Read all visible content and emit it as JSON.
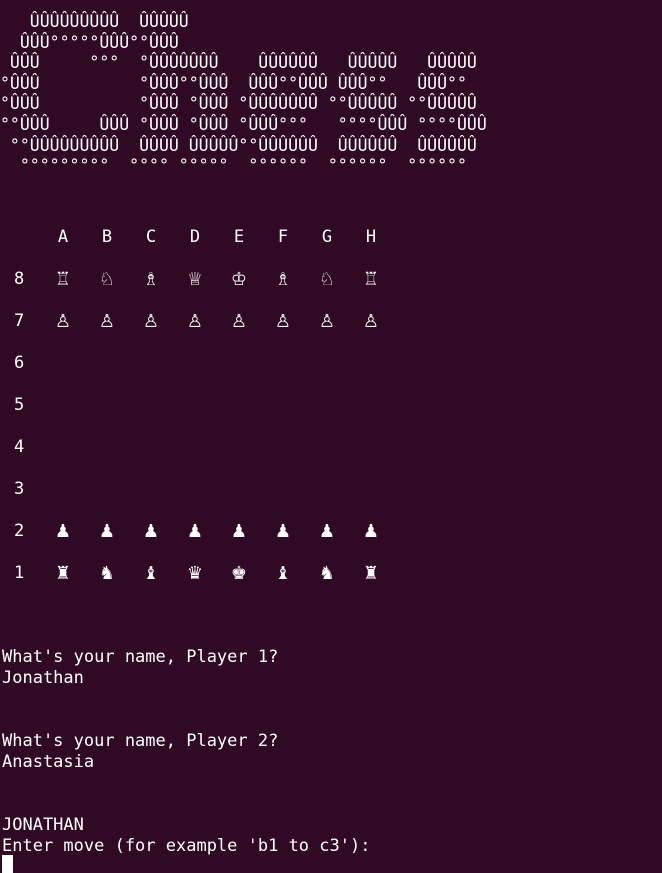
{
  "terminal": {
    "background": "#300a24",
    "foreground": "#ffffff"
  },
  "banner": {
    "text": "   ÛÛÛÛÛÛÛÛÛ  ÛÛÛÛÛ\n  ÛÛÛ°°°°°ÛÛÛ°°ÛÛÛ\n ÛÛÛ     °°°  °ÛÛÛÛÛÛÛ    ÛÛÛÛÛÛ   ÛÛÛÛÛ   ÛÛÛÛÛ\n°ÛÛÛ          °ÛÛÛ°°ÛÛÛ  ÛÛÛ°°ÛÛÛ ÛÛÛ°°   ÛÛÛ°°\n°ÛÛÛ          °ÛÛÛ °ÛÛÛ °ÛÛÛÛÛÛÛ °°ÛÛÛÛÛ °°ÛÛÛÛÛ\n°°ÛÛÛ     ÛÛÛ °ÛÛÛ °ÛÛÛ °ÛÛÛ°°°   °°°°ÛÛÛ °°°°ÛÛÛ\n °°ÛÛÛÛÛÛÛÛÛ  ÛÛÛÛ ÛÛÛÛÛ°°ÛÛÛÛÛÛ  ÛÛÛÛÛÛ  ÛÛÛÛÛÛ\n  °°°°°°°°°  °°°° °°°°°  °°°°°°  °°°°°°  °°°°°°"
  },
  "board": {
    "files": [
      "A",
      "B",
      "C",
      "D",
      "E",
      "F",
      "G",
      "H"
    ],
    "ranks": [
      "8",
      "7",
      "6",
      "5",
      "4",
      "3",
      "2",
      "1"
    ],
    "rows": [
      [
        "♖",
        "♘",
        "♗",
        "♕",
        "♔",
        "♗",
        "♘",
        "♖"
      ],
      [
        "♙",
        "♙",
        "♙",
        "♙",
        "♙",
        "♙",
        "♙",
        "♙"
      ],
      [
        "",
        "",
        "",
        "",
        "",
        "",
        "",
        ""
      ],
      [
        "",
        "",
        "",
        "",
        "",
        "",
        "",
        ""
      ],
      [
        "",
        "",
        "",
        "",
        "",
        "",
        "",
        ""
      ],
      [
        "",
        "",
        "",
        "",
        "",
        "",
        "",
        ""
      ],
      [
        "♟",
        "♟",
        "♟",
        "♟",
        "♟",
        "♟",
        "♟",
        "♟"
      ],
      [
        "♜",
        "♞",
        "♝",
        "♛",
        "♚",
        "♝",
        "♞",
        "♜"
      ]
    ]
  },
  "dialog": {
    "prompt1": "What's your name, Player 1?",
    "answer1": "Jonathan",
    "prompt2": "What's your name, Player 2?",
    "answer2": "Anastasia",
    "current_player": "JONATHAN",
    "move_prompt": "Enter move (for example 'b1 to c3'):"
  }
}
